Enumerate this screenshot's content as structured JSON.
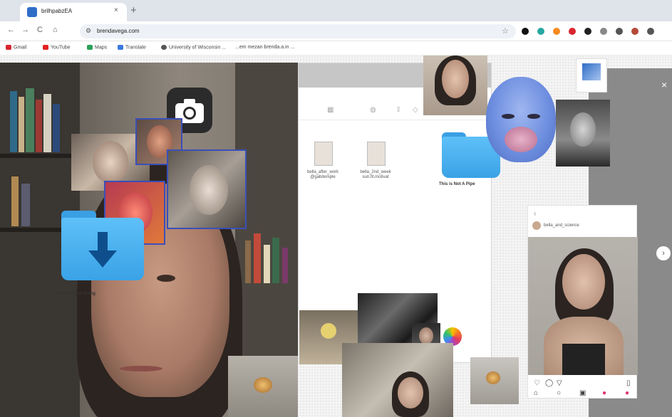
{
  "browser": {
    "tab_title": "brilhpabzEA",
    "tab_close": "×",
    "new_tab": "+",
    "back": "←",
    "forward": "→",
    "reload": "C",
    "home": "⌂",
    "url": "brendavega.com",
    "star": "☆",
    "extension_colors": [
      "#111111",
      "#27a7a2",
      "#f58a1f",
      "#d8262e",
      "#222222",
      "#888888",
      "#555555",
      "#b34a3a",
      "#555555"
    ]
  },
  "bookmarks": [
    {
      "label": "Gmail",
      "color": "#d8262e"
    },
    {
      "label": "YouTube",
      "color": "#e52222"
    },
    {
      "label": "Maps",
      "color": "#2aa05a"
    },
    {
      "label": "Translate",
      "color": "#3a78e0"
    },
    {
      "label": "University of Wisconsin ...",
      "color": "#555555"
    },
    {
      "label": "...em mezan brenda.a.in ...",
      "color": "#888888"
    }
  ],
  "folders": [
    {
      "caption": "For The Time Being"
    },
    {
      "caption": "This is Not A Pipe"
    }
  ],
  "finder_files": [
    {
      "caption": "bella_after_work @gabitemple"
    },
    {
      "caption": "bella_2nd_week sun.fit.motivat"
    }
  ],
  "instagram": {
    "handle": "bella_and_science"
  },
  "modal": {
    "close": "×",
    "next": "›"
  },
  "theme": {
    "folder_blue": "#5ec0f8",
    "thumb_border_blue": "#3a4fb8"
  }
}
